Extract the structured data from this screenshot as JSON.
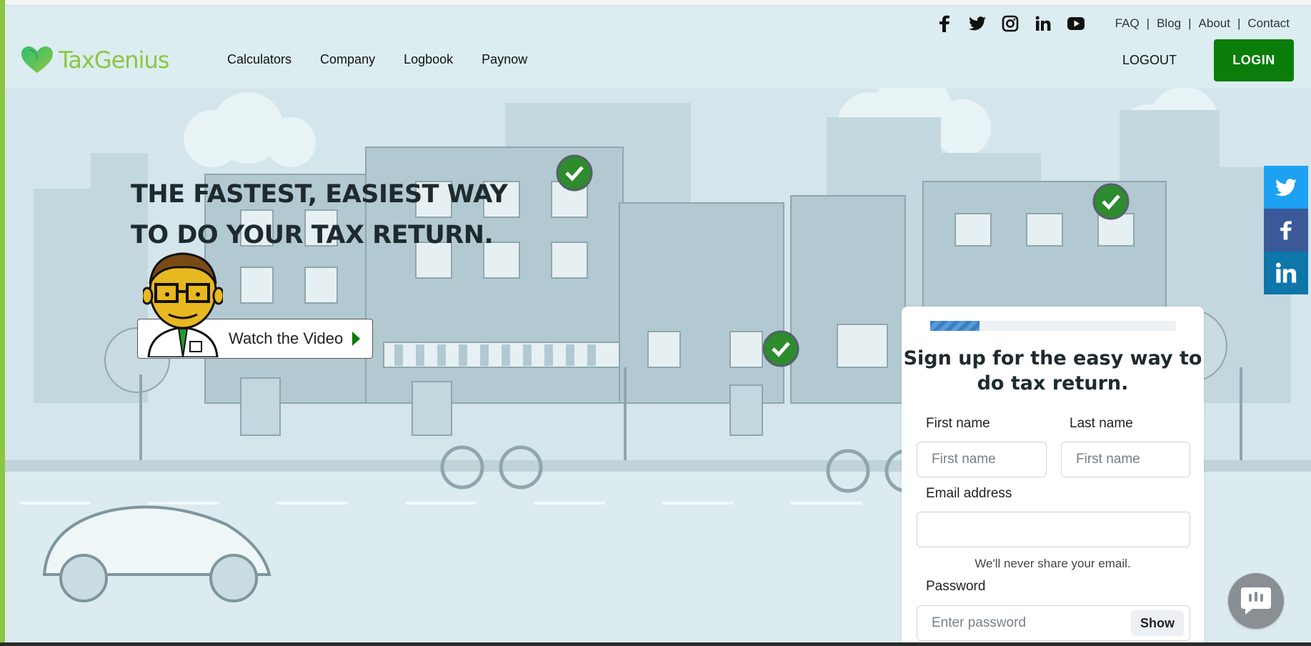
{
  "brand": {
    "name": "TaxGenius",
    "accent": "#8cc63f",
    "button_green": "#0a7d0a"
  },
  "topbar": {
    "social_icons": [
      "facebook-icon",
      "twitter-icon",
      "instagram-icon",
      "linkedin-icon",
      "youtube-icon"
    ],
    "links": [
      "FAQ",
      "Blog",
      "About",
      "Contact"
    ]
  },
  "nav": {
    "items": [
      "Calculators",
      "Company",
      "Logbook",
      "Paynow"
    ],
    "logout": "LOGOUT",
    "login": "LOGIN"
  },
  "hero": {
    "headline_line1": "THE FASTEST, EASIEST WAY",
    "headline_line2": "TO DO YOUR TAX RETURN.",
    "video_label": "Watch the Video"
  },
  "share": {
    "icons": [
      "twitter-icon",
      "facebook-icon",
      "linkedin-icon"
    ],
    "colors": [
      "#1da1f2",
      "#3b5998",
      "#0e76a8"
    ]
  },
  "signup": {
    "progress": 0.2,
    "title_line1": "Sign up for the easy way to",
    "title_line2": "do tax return.",
    "first_name_label": "First name",
    "first_name_placeholder": "First name",
    "last_name_label": "Last name",
    "last_name_placeholder": "First name",
    "email_label": "Email address",
    "email_placeholder": "",
    "email_hint": "We'll never share your email.",
    "password_label": "Password",
    "password_placeholder": "Enter password",
    "show_label": "Show"
  },
  "chat": {
    "icon": "chat-icon"
  }
}
